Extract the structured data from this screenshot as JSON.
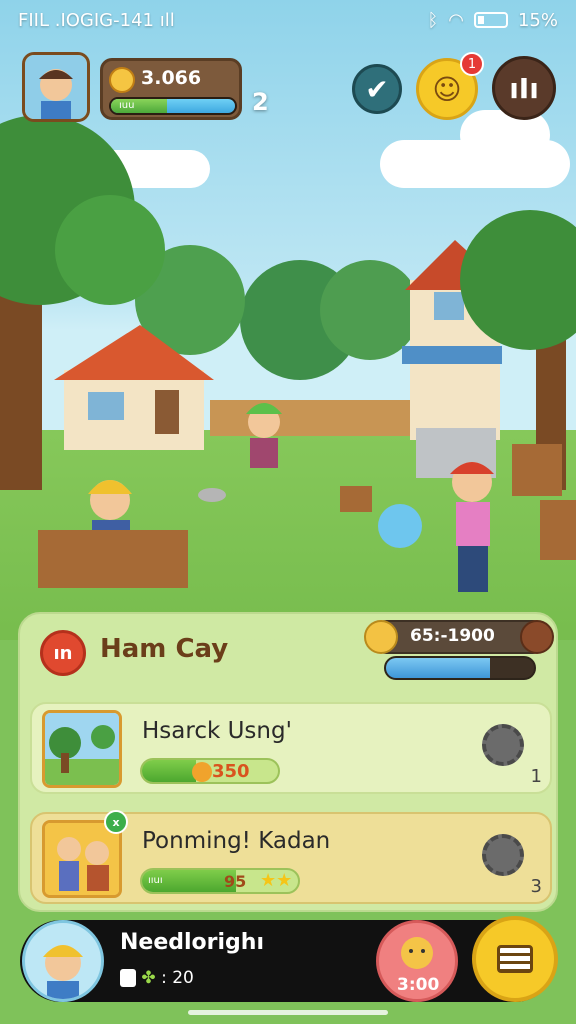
{
  "status_bar": {
    "left_text": "FIIL .IOGIG-141 ıll",
    "battery_text": "15%",
    "bluetooth_icon": "bluetooth-icon",
    "wifi_icon": "wifi-icon"
  },
  "hud": {
    "coins": "3.066",
    "xp_label": "ıuu",
    "xp_progress": 0.45,
    "level": "2",
    "notification_count": "1",
    "check_icon": "checkmark-icon",
    "chat_icon": "smiley-chat-icon",
    "menu_icon": "bars-menu-icon"
  },
  "panel": {
    "icon_text": "ın",
    "title": "Ham Cay",
    "score": "65:-1900",
    "score_progress": 0.7
  },
  "tasks": [
    {
      "title": "Hsarck Usng'",
      "reward": "350",
      "progress": 0.4,
      "count": "1"
    },
    {
      "title": "Ponming! Kadan",
      "reward": "95",
      "progress": 0.6,
      "bar_label": "ııuı",
      "stars": "★★",
      "count": "3",
      "badge": "x"
    }
  ],
  "player": {
    "name": "Needlorighı",
    "stat": ": 20",
    "reward": "3:00"
  }
}
